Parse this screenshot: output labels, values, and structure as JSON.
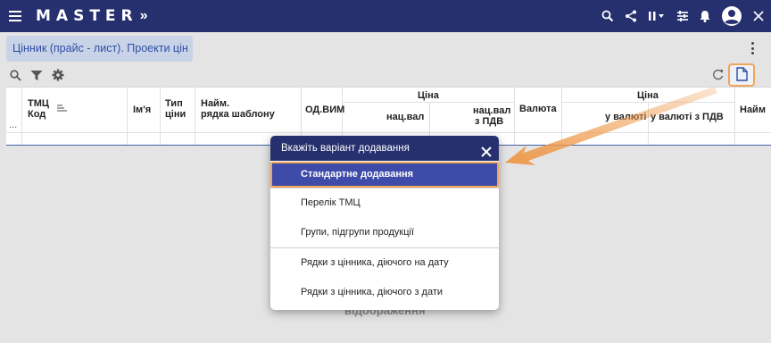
{
  "app": {
    "title": "MASTER",
    "chevron": "»"
  },
  "topbar_icons": [
    "search-icon",
    "share-icon",
    "pause-icon",
    "filter-list-icon",
    "bell-icon",
    "account-icon",
    "close-icon"
  ],
  "tab": {
    "label": "Цінник (прайс - лист). Проекти цін"
  },
  "table": {
    "columns": {
      "tmc": "ТМЦ",
      "kod": "Код",
      "imia": "Ім'я",
      "typ": "Тип",
      "tsiny": "ціни",
      "naim": "Найм.",
      "riadka": "рядка шаблону",
      "odvym": "ОД.ВИМ",
      "tsina_group": "Ціна",
      "nats_val": "нац.вал",
      "nats_val_pdv_1": "нац.вал",
      "nats_val_pdv_2": "з ПДВ",
      "valiuta": "Валюта",
      "tsina_group2": "Ціна",
      "u_valiuti": "у валюті",
      "u_valiuti_pdv": "у валюті з ПДВ",
      "naim2": "Найм",
      "more": "..."
    },
    "empty_text": "відображення"
  },
  "menu": {
    "title": "Вкажіть варіант додавання",
    "items": [
      "Стандартне додавання",
      "Перелік ТМЦ",
      "Групи, підгрупи продукції",
      "Рядки з цінника, діючого на дату",
      "Рядки з цінника, діючого з дати"
    ],
    "selected_index": 0
  },
  "colors": {
    "brand": "#26306e",
    "highlight": "#f0a55a",
    "selected": "#3f4ba8"
  }
}
